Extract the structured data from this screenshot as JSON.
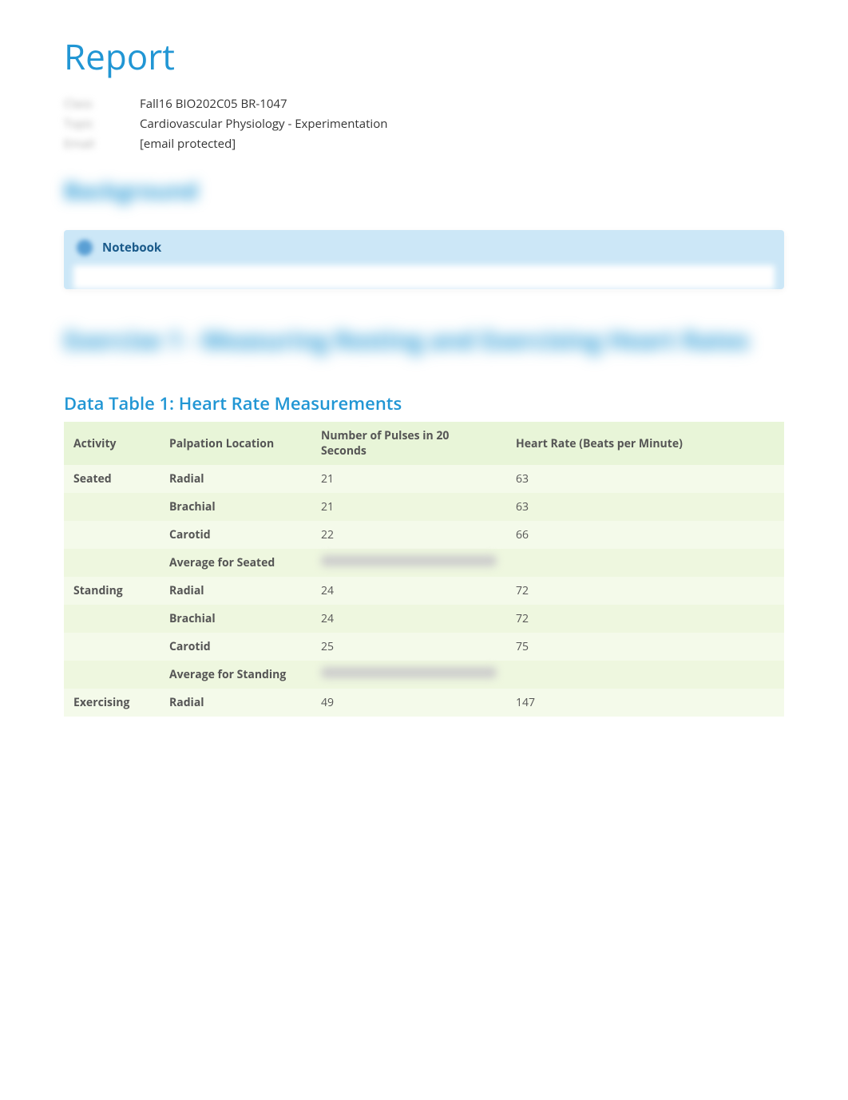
{
  "page_title": "Report",
  "meta": {
    "label1": "Class",
    "value1": "Fall16 BIO202C05 BR-1047",
    "label2": "Topic",
    "value2": "Cardiovascular Physiology - Experimentation",
    "label3": "Email",
    "value3": "[email protected]"
  },
  "background_heading": "Background",
  "notebook": {
    "title": "Notebook"
  },
  "exercise_heading": "Exercise 1 - Measuring Resting and Exercising Heart Rates",
  "table": {
    "title": "Data Table 1: Heart Rate Measurements",
    "headers": {
      "activity": "Activity",
      "palpation": "Palpation Location",
      "pulses": "Number of Pulses in 20 Seconds",
      "bpm": "Heart Rate (Beats per Minute)"
    },
    "rows": [
      {
        "activity": "Seated",
        "palpation": "Radial",
        "pulses": "21",
        "bpm": "63",
        "blurred": false
      },
      {
        "activity": "",
        "palpation": "Brachial",
        "pulses": "21",
        "bpm": "63",
        "blurred": false
      },
      {
        "activity": "",
        "palpation": "Carotid",
        "pulses": "22",
        "bpm": "66",
        "blurred": false
      },
      {
        "activity": "",
        "palpation": "Average for Seated",
        "pulses": "",
        "bpm": "",
        "blurred": true
      },
      {
        "activity": "Standing",
        "palpation": "Radial",
        "pulses": "24",
        "bpm": "72",
        "blurred": false
      },
      {
        "activity": "",
        "palpation": "Brachial",
        "pulses": "24",
        "bpm": "72",
        "blurred": false
      },
      {
        "activity": "",
        "palpation": "Carotid",
        "pulses": "25",
        "bpm": "75",
        "blurred": false
      },
      {
        "activity": "",
        "palpation": "Average for Standing",
        "pulses": "",
        "bpm": "",
        "blurred": true
      },
      {
        "activity": "Exercising",
        "palpation": "Radial",
        "pulses": "49",
        "bpm": "147",
        "blurred": false
      }
    ]
  }
}
